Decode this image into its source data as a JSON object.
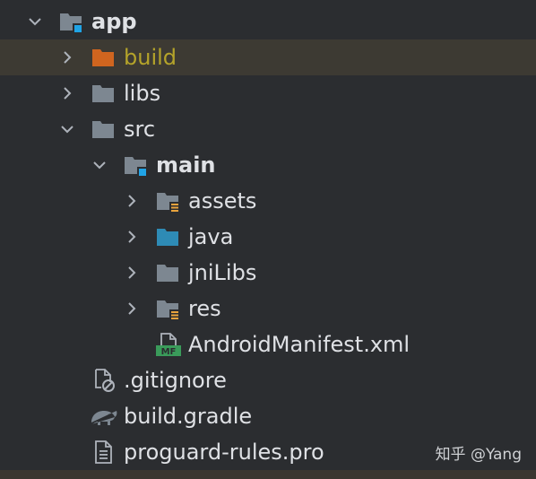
{
  "tree": {
    "app": "app",
    "build": "build",
    "libs": "libs",
    "src": "src",
    "main": "main",
    "assets": "assets",
    "java": "java",
    "jniLibs": "jniLibs",
    "res": "res",
    "manifest": "AndroidManifest.xml",
    "manifest_badge": "MF",
    "gitignore": ".gitignore",
    "build_gradle": "build.gradle",
    "proguard": "proguard-rules.pro"
  },
  "watermark": "知乎 @Yang",
  "colors": {
    "background": "#2b2d30",
    "selected_row": "#3d3a33",
    "folder": "#7d8791",
    "build_folder": "#d0651f",
    "build_text": "#b4a32a",
    "java_folder": "#2e8bb5",
    "module_badge": "#20a4e6",
    "resource_badge": "#e8a33d",
    "manifest_badge": "#3a9b5a"
  }
}
